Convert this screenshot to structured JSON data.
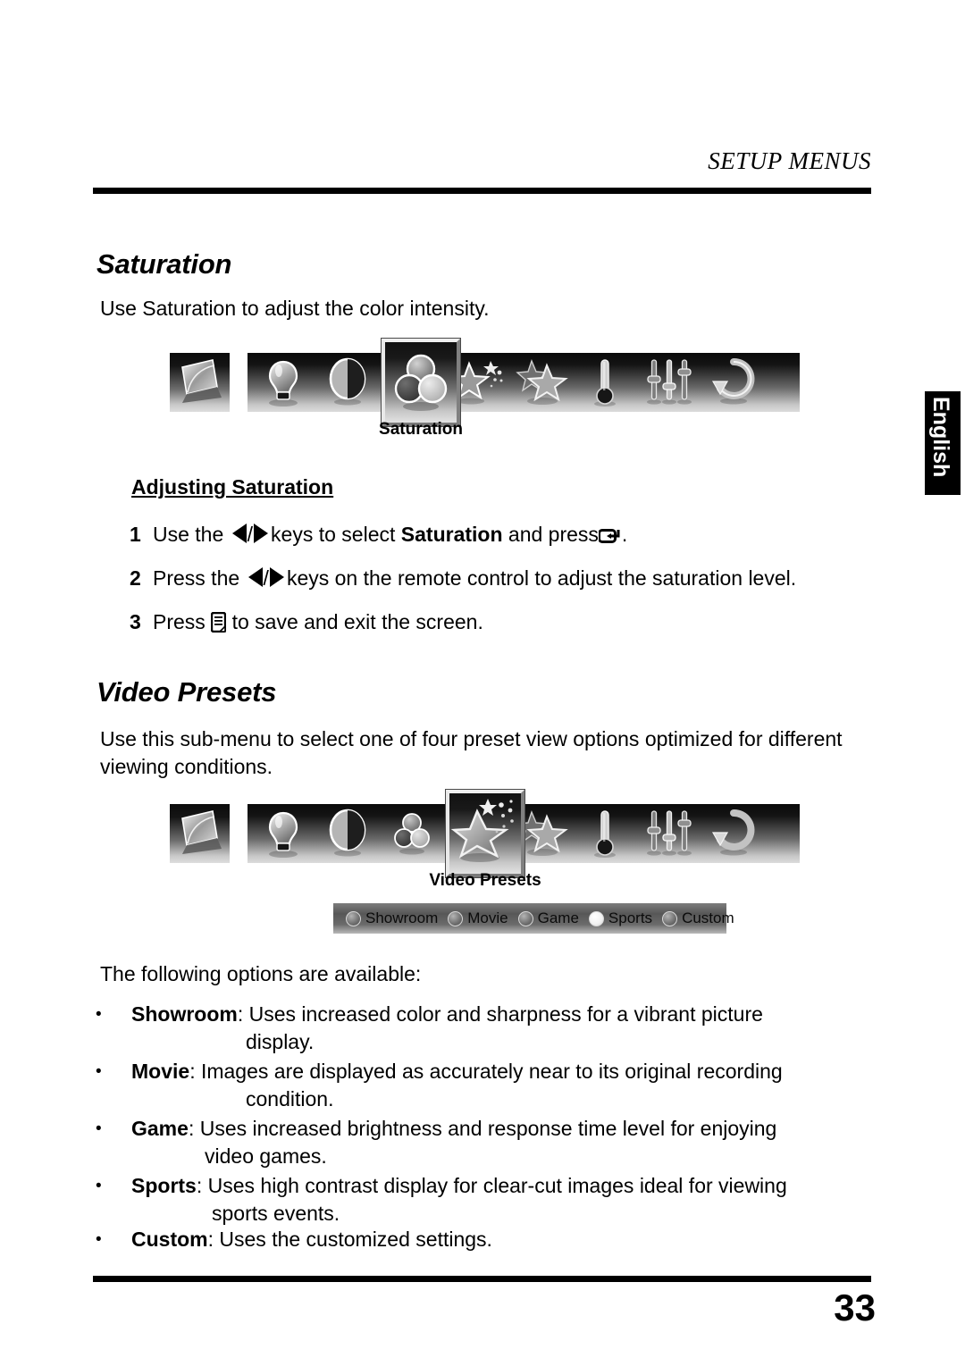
{
  "header": {
    "title": "SETUP MENUS"
  },
  "language_tab": {
    "label": "English"
  },
  "footer": {
    "page_number": "33"
  },
  "sections": [
    {
      "id": "saturation",
      "heading": "Saturation",
      "intro": "Use Saturation to adjust the color intensity.",
      "sub_heading": "Adjusting Saturation",
      "steps": [
        {
          "number": "1",
          "before": "Use the",
          "middle": "keys to select",
          "bold_term": "Saturation",
          "after": "and press",
          "end": "."
        },
        {
          "number": "2",
          "before": "Press the",
          "middle": "keys on the remote control to adjust the saturation level."
        },
        {
          "number": "3",
          "before": "Press",
          "middle": "to save and exit the screen."
        }
      ],
      "osd": {
        "standalone_icon": "monitor-icon",
        "icons": [
          "lightbulb-icon",
          "contrast-icon",
          "saturation-icon",
          "sparkle-star-icon",
          "two-stars-icon",
          "thermometer-icon",
          "sliders-icon",
          "reset-arrow-icon"
        ],
        "selected_index": 2,
        "selected_label": "Saturation"
      }
    },
    {
      "id": "video-presets",
      "heading": "Video Presets",
      "intro": "Use this sub-menu to select one of four preset view options optimized for different viewing conditions.",
      "list_intro": "The following options are available:",
      "osd": {
        "standalone_icon": "monitor-icon",
        "icons": [
          "lightbulb-icon",
          "contrast-icon",
          "saturation-icon",
          "sparkle-star-icon",
          "two-stars-icon",
          "thermometer-icon",
          "sliders-icon",
          "reset-arrow-icon"
        ],
        "selected_index": 3,
        "selected_label": "Video Presets",
        "options": [
          {
            "label": "Showroom",
            "selected": false
          },
          {
            "label": "Movie",
            "selected": false
          },
          {
            "label": "Game",
            "selected": false
          },
          {
            "label": "Sports",
            "selected": true
          },
          {
            "label": "Custom",
            "selected": false
          }
        ]
      },
      "bullets": [
        {
          "term": "Showroom",
          "text": ": Uses increased color and sharpness for a vibrant picture",
          "continuation": "display."
        },
        {
          "term": "Movie",
          "text": ": Images are displayed as accurately near to its original recording",
          "continuation": "condition."
        },
        {
          "term": "Game",
          "text": ": Uses increased brightness and response time level for enjoying",
          "continuation": "video games."
        },
        {
          "term": "Sports",
          "text": ": Uses high contrast display for clear-cut images ideal for viewing",
          "continuation": "sports events."
        },
        {
          "term": "Custom",
          "text": ": Uses the customized settings.",
          "continuation": ""
        }
      ]
    }
  ],
  "colors": {
    "ink": "#000000",
    "osd_dark": "#0a0a0a",
    "osd_light": "#dcdcdc",
    "tab_background": "#000000",
    "tab_text": "#ffffff"
  }
}
